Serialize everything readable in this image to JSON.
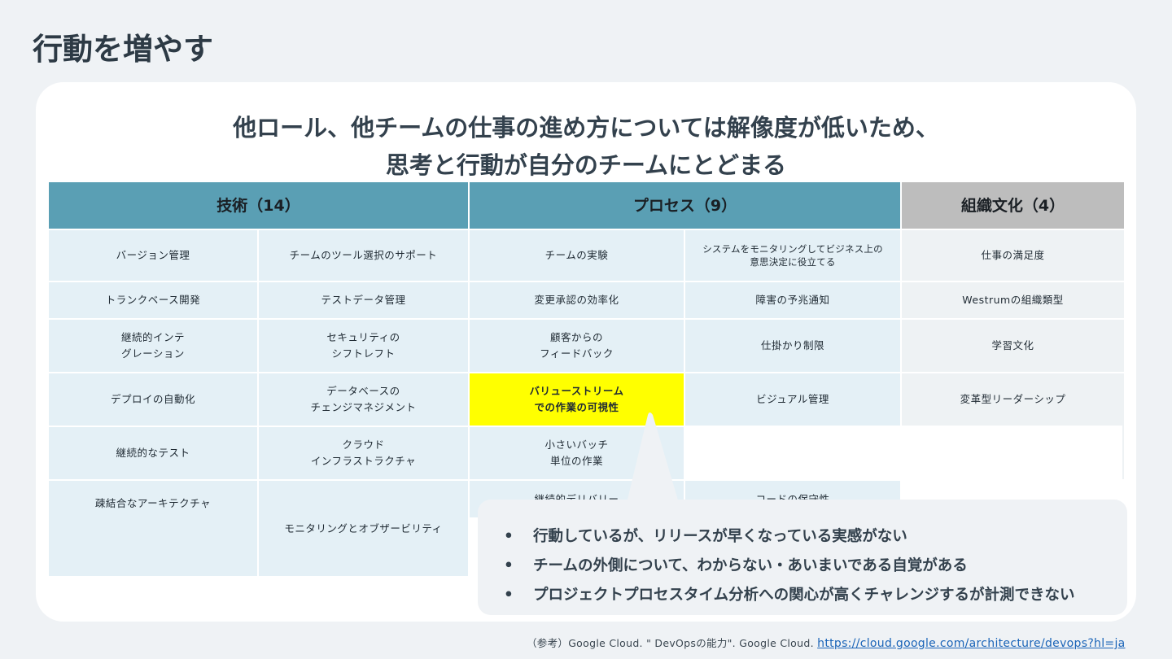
{
  "slide_title": "行動を増やす",
  "headline": {
    "line1": "他ロール、他チームの仕事の進め方については解像度が低いため、",
    "line2": "思考と行動が自分のチームにとどまる"
  },
  "table": {
    "headers": {
      "tech": "技術（14）",
      "process": "プロセス（9）",
      "culture": "組織文化（4）"
    },
    "tech_col1": [
      "バージョン管理",
      "トランクベース開発",
      "継続的インテ\nグレーション",
      "デプロイの自動化",
      "継続的なテスト",
      "継続的デリバリー",
      "疎結合なアーキテクチャ"
    ],
    "tech_col2": [
      "チームのツール選択のサポート",
      "テストデータ管理",
      "セキュリティの\nシフトレフト",
      "データベースの\nチェンジマネジメント",
      "クラウド\nインフラストラクチャ",
      "コードの保守性",
      "モニタリングとオブザービリティ"
    ],
    "process_col1": [
      "チームの実験",
      "変更承認の効率化",
      "顧客からの\nフィードバック",
      "バリューストリーム\nでの作業の可視性",
      "小さいバッチ\n単位の作業"
    ],
    "process_col2": [
      "システムをモニタリングしてビジネス上の\n意思決定に役立てる",
      "障害の予兆通知",
      "仕掛かり制限",
      "ビジュアル管理"
    ],
    "culture_col": [
      "仕事の満足度",
      "Westrumの組織類型",
      "学習文化",
      "変革型リーダーシップ"
    ]
  },
  "callout": {
    "bullet": "•",
    "items": [
      "行動しているが、リリースが早くなっている実感がない",
      "チームの外側について、わからない・あいまいである自覚がある",
      "プロジェクトプロセスタイム分析への関心が高くチャレンジするが計測できない"
    ]
  },
  "footer": {
    "ref_text": "（参考）Google Cloud. \" DevOpsの能力\". Google Cloud.",
    "link_text": "https://cloud.google.com/architecture/devops?hl=ja"
  },
  "colors": {
    "header_teal": "#5a9fb4",
    "header_gray": "#bdbdbd",
    "cell_blue": "#e4f0f6",
    "cell_gray": "#eef2f4",
    "highlight": "#ffff00"
  }
}
